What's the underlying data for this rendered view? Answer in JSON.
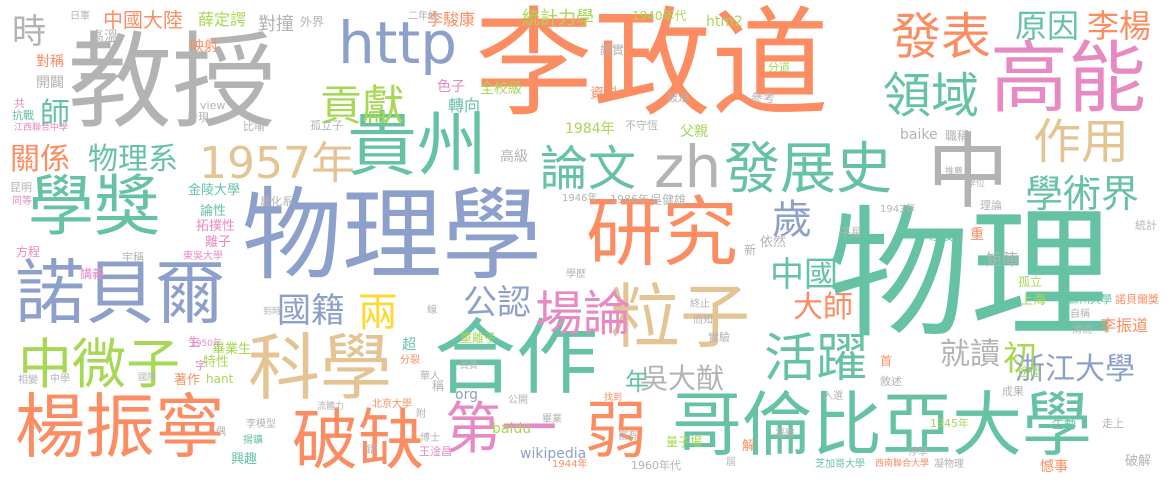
{
  "palette": [
    "#66c2a5",
    "#fc8d62",
    "#8da0cb",
    "#e78ac3",
    "#a6d854",
    "#ffd92f",
    "#e5c494",
    "#b3b3b3"
  ],
  "words": [
    {
      "t": "物理",
      "c": 0
    },
    {
      "t": "李政道",
      "c": 1
    },
    {
      "t": "物理學",
      "c": 2
    },
    {
      "t": "教授",
      "c": 7
    },
    {
      "t": "楊振寧",
      "c": 1
    },
    {
      "t": "哥倫比亞大學",
      "c": 0
    },
    {
      "t": "合作",
      "c": 0
    },
    {
      "t": "研究",
      "c": 1
    },
    {
      "t": "高能",
      "c": 3
    },
    {
      "t": "中",
      "c": 7
    },
    {
      "t": "學獎",
      "c": 0
    },
    {
      "t": "諾貝爾",
      "c": 2
    },
    {
      "t": "貴州",
      "c": 0
    },
    {
      "t": "科學",
      "c": 6
    },
    {
      "t": "粒子",
      "c": 6
    },
    {
      "t": "破缺",
      "c": 1
    },
    {
      "t": "中微子",
      "c": 4
    },
    {
      "t": "發展史",
      "c": 0
    },
    {
      "t": "http",
      "c": 2
    },
    {
      "t": "zh",
      "c": 7
    },
    {
      "t": "第一",
      "c": 3
    },
    {
      "t": "弱",
      "c": 1
    },
    {
      "t": "活躍",
      "c": 0
    },
    {
      "t": "場論",
      "c": 3
    },
    {
      "t": "1957年",
      "c": 6
    },
    {
      "t": "作用",
      "c": 6
    },
    {
      "t": "發表",
      "c": 1
    },
    {
      "t": "領域",
      "c": 0
    },
    {
      "t": "貢獻",
      "c": 4
    },
    {
      "t": "論文",
      "c": 0
    },
    {
      "t": "原因",
      "c": 0
    },
    {
      "t": "李楊",
      "c": 1
    },
    {
      "t": "學術界",
      "c": 0
    },
    {
      "t": "歲",
      "c": 2
    },
    {
      "t": "中國",
      "c": 0
    },
    {
      "t": "國籍",
      "c": 2
    },
    {
      "t": "公認",
      "c": 2
    },
    {
      "t": "兩",
      "c": 5
    },
    {
      "t": "關係",
      "c": 1
    },
    {
      "t": "物理系",
      "c": 0
    },
    {
      "t": "時",
      "c": 7
    },
    {
      "t": "師",
      "c": 0
    },
    {
      "t": "大師",
      "c": 1
    },
    {
      "t": "就讀",
      "c": 7
    },
    {
      "t": "初",
      "c": 4
    },
    {
      "t": "浙江大學",
      "c": 2
    },
    {
      "t": "吳大猷",
      "c": 7
    },
    {
      "t": "年",
      "c": 0
    },
    {
      "t": "中國大陸",
      "c": 1
    },
    {
      "t": "薛定諤",
      "c": 4
    },
    {
      "t": "對撞",
      "c": 7
    },
    {
      "t": "外界",
      "c": 7
    },
    {
      "t": "李駿康",
      "c": 1
    },
    {
      "t": "統計力學",
      "c": 4
    },
    {
      "t": "1940年代",
      "c": 4
    },
    {
      "t": "htm2",
      "c": 4
    },
    {
      "t": "高溫",
      "c": 7
    },
    {
      "t": "映射",
      "c": 1
    },
    {
      "t": "日軍",
      "c": 7
    },
    {
      "t": "二年級",
      "c": 7
    },
    {
      "t": "證實",
      "c": 7
    },
    {
      "t": "色子",
      "c": 3
    },
    {
      "t": "轉向",
      "c": 0
    },
    {
      "t": "全校級",
      "c": 4
    },
    {
      "t": "資料",
      "c": 1
    },
    {
      "t": "被迫",
      "c": 7
    },
    {
      "t": "分道",
      "c": 4
    },
    {
      "t": "參考",
      "c": 7
    },
    {
      "t": "對稱",
      "c": 1
    },
    {
      "t": "開闢",
      "c": 7
    },
    {
      "t": "共",
      "c": 3
    },
    {
      "t": "抗戰",
      "c": 0
    },
    {
      "t": "江西聯合中學",
      "c": 3
    },
    {
      "t": "比喻",
      "c": 7
    },
    {
      "t": "view",
      "c": 7
    },
    {
      "t": "發現",
      "c": 7
    },
    {
      "t": "孤立子",
      "c": 7
    },
    {
      "t": "1984年",
      "c": 4
    },
    {
      "t": "不守恆",
      "c": 7
    },
    {
      "t": "父親",
      "c": 4
    },
    {
      "t": "職稱",
      "c": 7
    },
    {
      "t": "baike",
      "c": 7
    },
    {
      "t": "昆明",
      "c": 7
    },
    {
      "t": "高級",
      "c": 7
    },
    {
      "t": "同等",
      "c": 3
    },
    {
      "t": "金陵大學",
      "c": 0
    },
    {
      "t": "論性",
      "c": 0
    },
    {
      "t": "拓撲性",
      "c": 3
    },
    {
      "t": "離子",
      "c": 3
    },
    {
      "t": "1946年",
      "c": 7
    },
    {
      "t": "1986年",
      "c": 7
    },
    {
      "t": "吳健雄",
      "c": 7
    },
    {
      "t": "1943年",
      "c": 7
    },
    {
      "t": "理論",
      "c": 7
    },
    {
      "t": "統計",
      "c": 7
    },
    {
      "t": "方程",
      "c": 3
    },
    {
      "t": "講義",
      "c": 3
    },
    {
      "t": "宇稱",
      "c": 7
    },
    {
      "t": "東吳大學",
      "c": 3
    },
    {
      "t": "農化系",
      "c": 7
    },
    {
      "t": "依然",
      "c": 7
    },
    {
      "t": "子星",
      "c": 7
    },
    {
      "t": "導玻",
      "c": 0
    },
    {
      "t": "矩陣",
      "c": 7
    },
    {
      "t": "重",
      "c": 1
    },
    {
      "t": "孤立",
      "c": 4
    },
    {
      "t": "上海",
      "c": 4
    },
    {
      "t": "蘇州大學",
      "c": 0
    },
    {
      "t": "諾貝爾獎",
      "c": 1
    },
    {
      "t": "李振道",
      "c": 1
    },
    {
      "t": "畢業生",
      "c": 4
    },
    {
      "t": "特性",
      "c": 4
    },
    {
      "t": "hant",
      "c": 4
    },
    {
      "t": "著作",
      "c": 1
    },
    {
      "t": "1950年",
      "c": 3
    },
    {
      "t": "超",
      "c": 0
    },
    {
      "t": "重離子",
      "c": 4
    },
    {
      "t": "實驗",
      "c": 7
    },
    {
      "t": "途徑",
      "c": 4
    },
    {
      "t": "清流",
      "c": 7
    },
    {
      "t": "org",
      "c": 2
    },
    {
      "t": "baidu",
      "c": 4
    },
    {
      "t": "wikipedia",
      "c": 2
    },
    {
      "t": "北京大學",
      "c": 1
    },
    {
      "t": "李模型",
      "c": 7
    },
    {
      "t": "王淦昌",
      "c": 3
    },
    {
      "t": "博士",
      "c": 7
    },
    {
      "t": "興趣",
      "c": 0
    },
    {
      "t": "1944年",
      "c": 1
    },
    {
      "t": "1960年代",
      "c": 7
    },
    {
      "t": "量子場",
      "c": 4
    },
    {
      "t": "解",
      "c": 1
    },
    {
      "t": "1945年",
      "c": 4
    },
    {
      "t": "生動",
      "c": 0
    },
    {
      "t": "芝加哥大學",
      "c": 0
    },
    {
      "t": "西南聯合大學",
      "c": 1
    },
    {
      "t": "憾事",
      "c": 1
    },
    {
      "t": "破解",
      "c": 7
    },
    {
      "t": "凝聚",
      "c": 7
    },
    {
      "t": "富有",
      "c": 7
    },
    {
      "t": "成果",
      "c": 7
    },
    {
      "t": "敘述",
      "c": 7
    },
    {
      "t": "入選",
      "c": 7
    },
    {
      "t": "公開",
      "c": 7
    },
    {
      "t": "找到",
      "c": 1
    },
    {
      "t": "國際",
      "c": 7
    },
    {
      "t": "分裂",
      "c": 1
    },
    {
      "t": "揚鑛",
      "c": 0
    },
    {
      "t": "流體力",
      "c": 7
    },
    {
      "t": "畢業",
      "c": 7
    },
    {
      "t": "中學",
      "c": 7
    },
    {
      "t": "相變",
      "c": 7
    },
    {
      "t": "稱",
      "c": 7
    },
    {
      "t": "終止",
      "c": 7
    },
    {
      "t": "新",
      "c": 7
    },
    {
      "t": "華人",
      "c": 7
    },
    {
      "t": "學歷",
      "c": 7
    },
    {
      "t": "線",
      "c": 7
    },
    {
      "t": "而知",
      "c": 7
    },
    {
      "t": "自稱",
      "c": 7
    },
    {
      "t": "推薦",
      "c": 7
    },
    {
      "t": "學位",
      "c": 7
    },
    {
      "t": "首",
      "c": 1
    },
    {
      "t": "凝物理",
      "c": 7
    },
    {
      "t": "停學",
      "c": 7
    },
    {
      "t": "走上",
      "c": 7
    },
    {
      "t": "屆",
      "c": 7
    },
    {
      "t": "到時",
      "c": 7
    },
    {
      "t": "員賣",
      "c": 7
    },
    {
      "t": "偶",
      "c": 7
    },
    {
      "t": "附",
      "c": 7
    },
    {
      "t": "錯",
      "c": 7
    },
    {
      "t": "生",
      "c": 3
    },
    {
      "t": "字",
      "c": 3
    }
  ]
}
